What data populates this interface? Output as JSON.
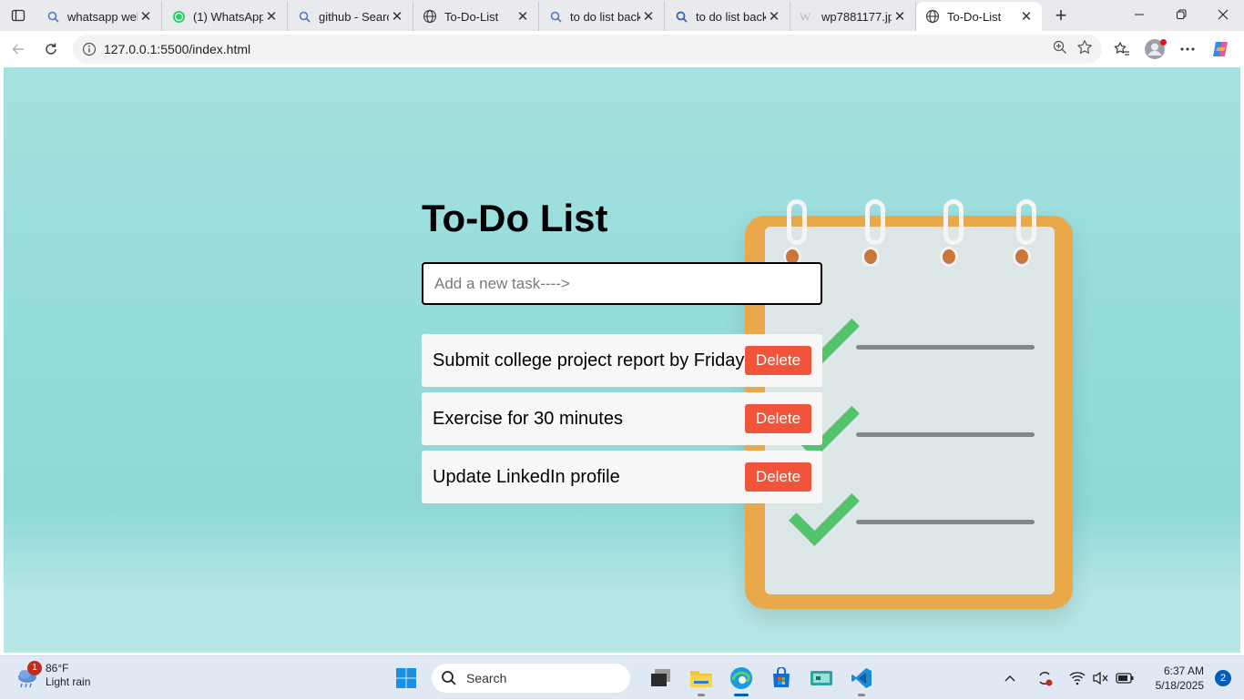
{
  "browser": {
    "tabs": [
      {
        "title": "whatsapp web",
        "icon": "search-icon"
      },
      {
        "title": "(1) WhatsApp",
        "icon": "whatsapp-icon"
      },
      {
        "title": "github - Search",
        "icon": "search-icon"
      },
      {
        "title": "To-Do-List",
        "icon": "globe-icon"
      },
      {
        "title": "to do list back",
        "icon": "search-icon"
      },
      {
        "title": "to do list back",
        "icon": "search-icon"
      },
      {
        "title": "wp7881177.jpg",
        "icon": "image-icon"
      },
      {
        "title": "To-Do-List",
        "icon": "globe-icon",
        "active": true
      }
    ],
    "url": "127.0.0.1:5500/index.html"
  },
  "app": {
    "title": "To-Do List",
    "input_placeholder": "Add a new task---->",
    "input_value": "",
    "delete_label": "Delete",
    "tasks": [
      {
        "text": "Submit college project report by Friday"
      },
      {
        "text": "Exercise for 30 minutes"
      },
      {
        "text": "Update LinkedIn profile"
      }
    ],
    "colors": {
      "delete_button": "#f1533b",
      "background": "#96dada",
      "checkmark": "#52c46c",
      "notepad_frame": "#e9a84a"
    }
  },
  "taskbar": {
    "weather_temp": "86°F",
    "weather_desc": "Light rain",
    "weather_badge": "1",
    "search_label": "Search",
    "time": "6:37 AM",
    "date": "5/18/2025",
    "notification_count": "2"
  }
}
